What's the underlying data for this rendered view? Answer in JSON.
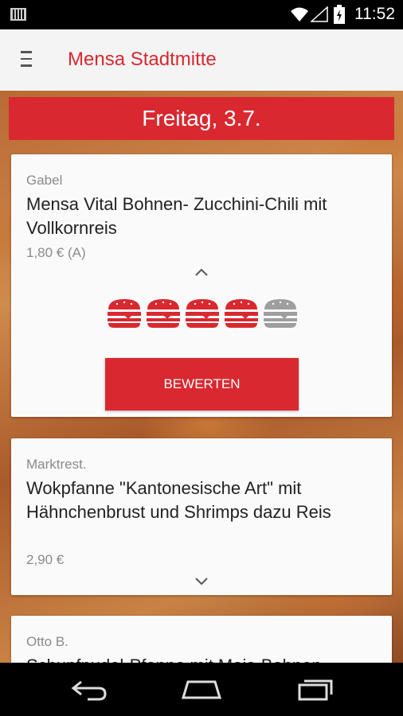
{
  "status_bar": {
    "time": "11:52"
  },
  "app_bar": {
    "title": "Mensa Stadtmitte"
  },
  "day_header": {
    "label": "Freitag, 3.7."
  },
  "meals": [
    {
      "location": "Gabel",
      "name": "Mensa Vital Bohnen- Zucchini-Chili mit Vollkornreis",
      "price": "1,80 € (A)",
      "rating": 4,
      "rating_max": 5,
      "rate_button": "BEWERTEN"
    },
    {
      "location": "Marktrest.",
      "name": "Wokpfanne \"Kantonesische Art\" mit Hähnchenbrust und Shrimps dazu Reis",
      "price": "2,90 €"
    },
    {
      "location": "Otto B.",
      "name": "Schupfnudel-Pfanne mit Mais-Bohnen"
    }
  ],
  "colors": {
    "accent": "#d9282f",
    "burger_active": "#d9282f",
    "burger_inactive": "#9e9e9e"
  }
}
